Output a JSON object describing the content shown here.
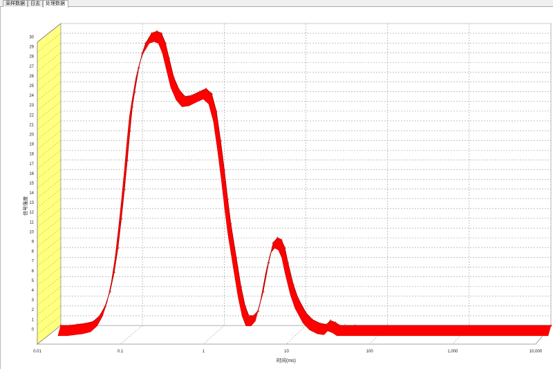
{
  "tabs": [
    {
      "label": "采样数据",
      "active": false
    },
    {
      "label": "日志",
      "active": false
    },
    {
      "label": "处理数据",
      "active": true
    }
  ],
  "colors": {
    "series": "#ff0000",
    "wall": "#ffff80",
    "grid": "#9a9a9a"
  },
  "chart_data": {
    "type": "area",
    "xlabel": "时间(ms)",
    "ylabel": "信号强度",
    "xscale": "log",
    "xlim": [
      0.01,
      10000
    ],
    "ylim": [
      0,
      31
    ],
    "x_ticks": [
      {
        "value": 0.01,
        "label": "0.01"
      },
      {
        "value": 0.1,
        "label": "0.1"
      },
      {
        "value": 1,
        "label": "1"
      },
      {
        "value": 10,
        "label": "10"
      },
      {
        "value": 100,
        "label": "100"
      },
      {
        "value": 1000,
        "label": "1,000"
      },
      {
        "value": 10000,
        "label": "10,000"
      }
    ],
    "y_ticks": [
      "0",
      "1",
      "2",
      "3",
      "4",
      "5",
      "6",
      "7",
      "8",
      "9",
      "10",
      "11",
      "12",
      "13",
      "14",
      "15",
      "16",
      "17",
      "18",
      "19",
      "20",
      "21",
      "22",
      "23",
      "24",
      "25",
      "26",
      "27",
      "28",
      "29",
      "30"
    ],
    "grid": true,
    "legend": "none",
    "series": [
      {
        "x": [
          0.01,
          0.013,
          0.016,
          0.02,
          0.025,
          0.03,
          0.035,
          0.04,
          0.045,
          0.05,
          0.055,
          0.06,
          0.065,
          0.07,
          0.075,
          0.08,
          0.09,
          0.1,
          0.11,
          0.12,
          0.13,
          0.15,
          0.17,
          0.19,
          0.21,
          0.24,
          0.28,
          0.33,
          0.4,
          0.5,
          0.6,
          0.7,
          0.8,
          0.9,
          1.0,
          1.1,
          1.2,
          1.4,
          1.6,
          1.8,
          2.0,
          2.3,
          2.6,
          3.0,
          3.5,
          4.0,
          4.5,
          5.0,
          5.5,
          6.0,
          7.0,
          8.0,
          10,
          12,
          15,
          18,
          20,
          23,
          26,
          30,
          40,
          100,
          1000,
          10000
        ],
        "y": [
          0,
          0,
          0.1,
          0.2,
          0.4,
          1,
          2,
          3.5,
          5.5,
          8,
          11,
          14,
          17,
          20,
          22.5,
          24,
          26.5,
          28,
          29,
          29.5,
          30,
          30.2,
          30,
          29,
          27.5,
          25.5,
          24.2,
          23.5,
          23.6,
          24,
          24.3,
          23.8,
          22,
          19,
          16,
          13,
          10.5,
          7,
          4,
          2,
          1,
          1,
          1.5,
          3.5,
          6.5,
          8.5,
          9,
          8.8,
          8,
          6.5,
          4.2,
          2.8,
          1.3,
          0.6,
          0.2,
          0.1,
          0.5,
          0.3,
          0,
          0,
          0,
          0,
          0,
          0
        ]
      }
    ]
  }
}
